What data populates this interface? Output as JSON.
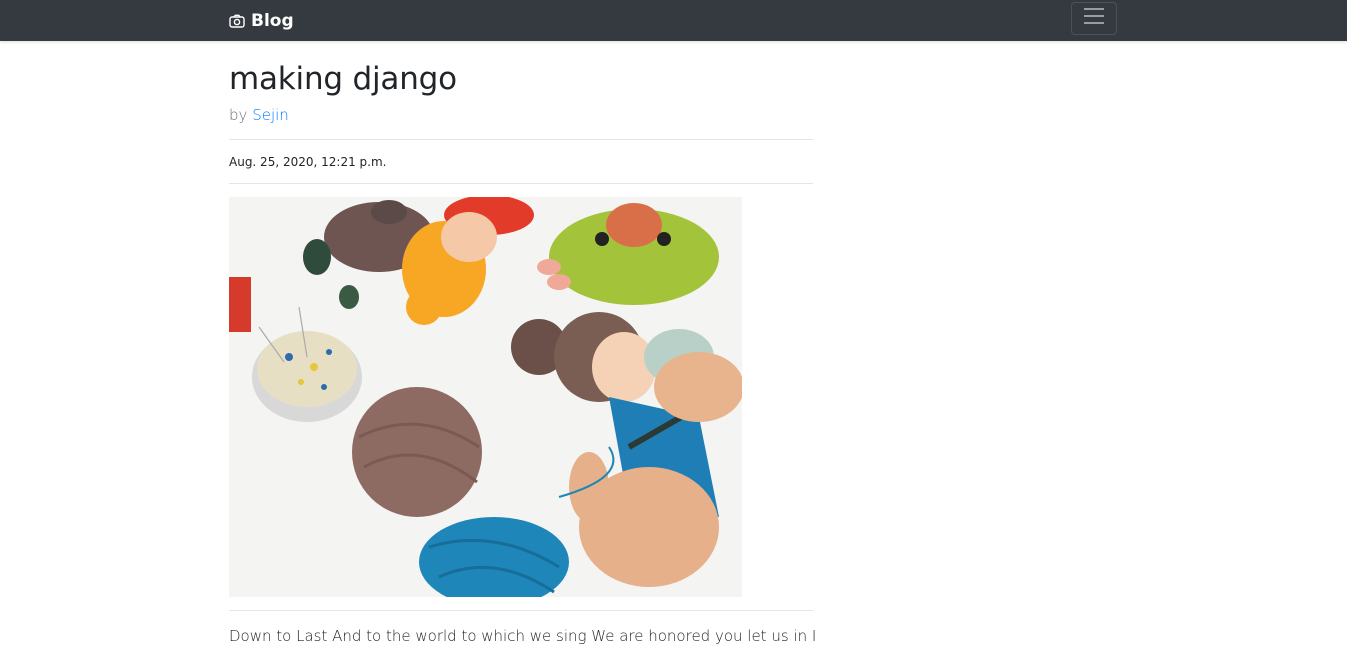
{
  "navbar": {
    "brand_label": "Blog",
    "brand_icon": "camera-icon",
    "toggler_icon": "hamburger-menu-icon",
    "background": "#343a40"
  },
  "post": {
    "title": "making django",
    "by_label": "by",
    "author": "Sejin",
    "date": "Aug. 25, 2020, 12:21 p.m.",
    "image": "crochet-dolls-and-yarn-photo",
    "body": "Down to Last And to the world to which we sing We are honored you let us in I"
  },
  "colors": {
    "link": "#007bff",
    "muted": "#6c757d"
  }
}
